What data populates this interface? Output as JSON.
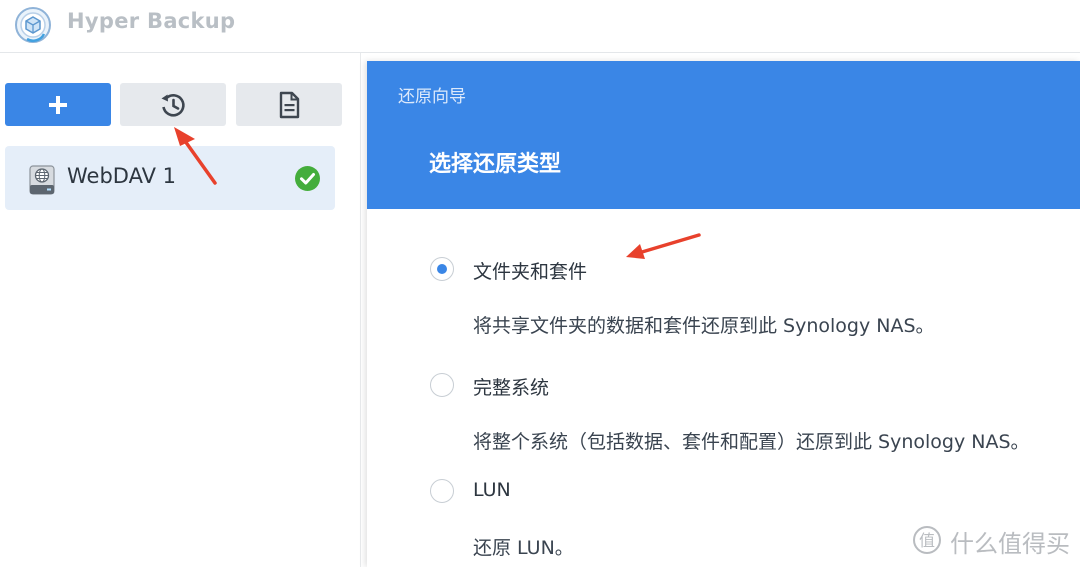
{
  "app": {
    "title": "Hyper Backup"
  },
  "toolbar": {
    "add_icon": "plus-icon",
    "restore_icon": "restore-history-icon",
    "log_icon": "document-log-icon"
  },
  "tasks": [
    {
      "label": "WebDAV 1",
      "icon": "webdav-drive-icon",
      "status_icon": "success-check-icon",
      "status_color": "#44ad3c"
    }
  ],
  "wizard": {
    "caption": "还原向导",
    "heading": "选择还原类型",
    "options": [
      {
        "label": "文件夹和套件",
        "description": "将共享文件夹的数据和套件还原到此 Synology NAS。",
        "selected": true
      },
      {
        "label": "完整系统",
        "description": "将整个系统（包括数据、套件和配置）还原到此 Synology NAS。",
        "selected": false
      },
      {
        "label": "LUN",
        "description": "还原 LUN。",
        "selected": false
      }
    ]
  },
  "watermark": {
    "text": "什么值得买"
  },
  "colors": {
    "accent": "#3a86e6",
    "annotation_arrow": "#e8412c",
    "selected_task_bg": "#e5eef9"
  }
}
